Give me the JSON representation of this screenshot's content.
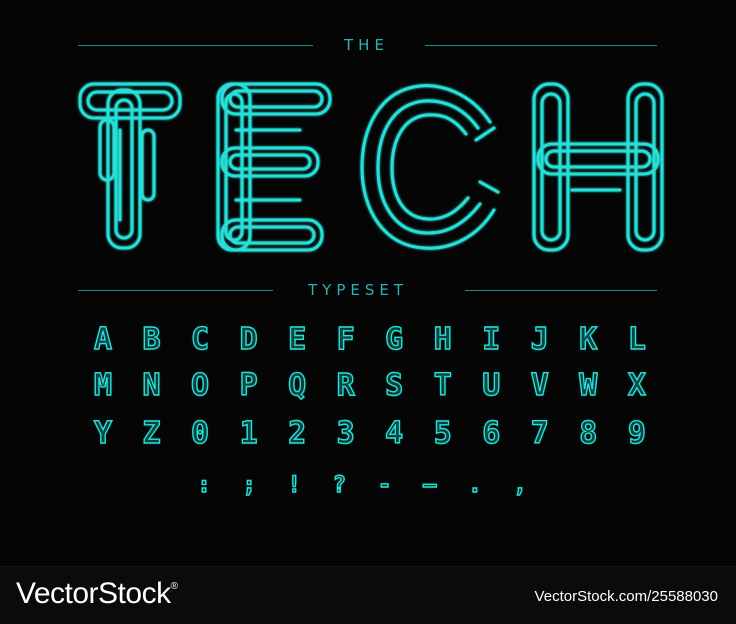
{
  "poster": {
    "top_label": "THE",
    "headline": "TECH",
    "sub_label": "TYPESET",
    "accent_color": "#27e0d8",
    "rule_color": "#1f8c8c",
    "background_color": "#050505"
  },
  "glyph_rows": [
    [
      "A",
      "B",
      "C",
      "D",
      "E",
      "F",
      "G",
      "H",
      "I",
      "J",
      "K",
      "L"
    ],
    [
      "M",
      "N",
      "O",
      "P",
      "Q",
      "R",
      "S",
      "T",
      "U",
      "V",
      "W",
      "X"
    ],
    [
      "Y",
      "Z",
      "0",
      "1",
      "2",
      "3",
      "4",
      "5",
      "6",
      "7",
      "8",
      "9"
    ],
    [
      ":",
      ";",
      "!",
      "?",
      "-",
      "–",
      ".",
      ","
    ]
  ],
  "footer": {
    "brand": "VectorStock",
    "registered_mark": "®",
    "credit": "VectorStock.com/25588030"
  }
}
